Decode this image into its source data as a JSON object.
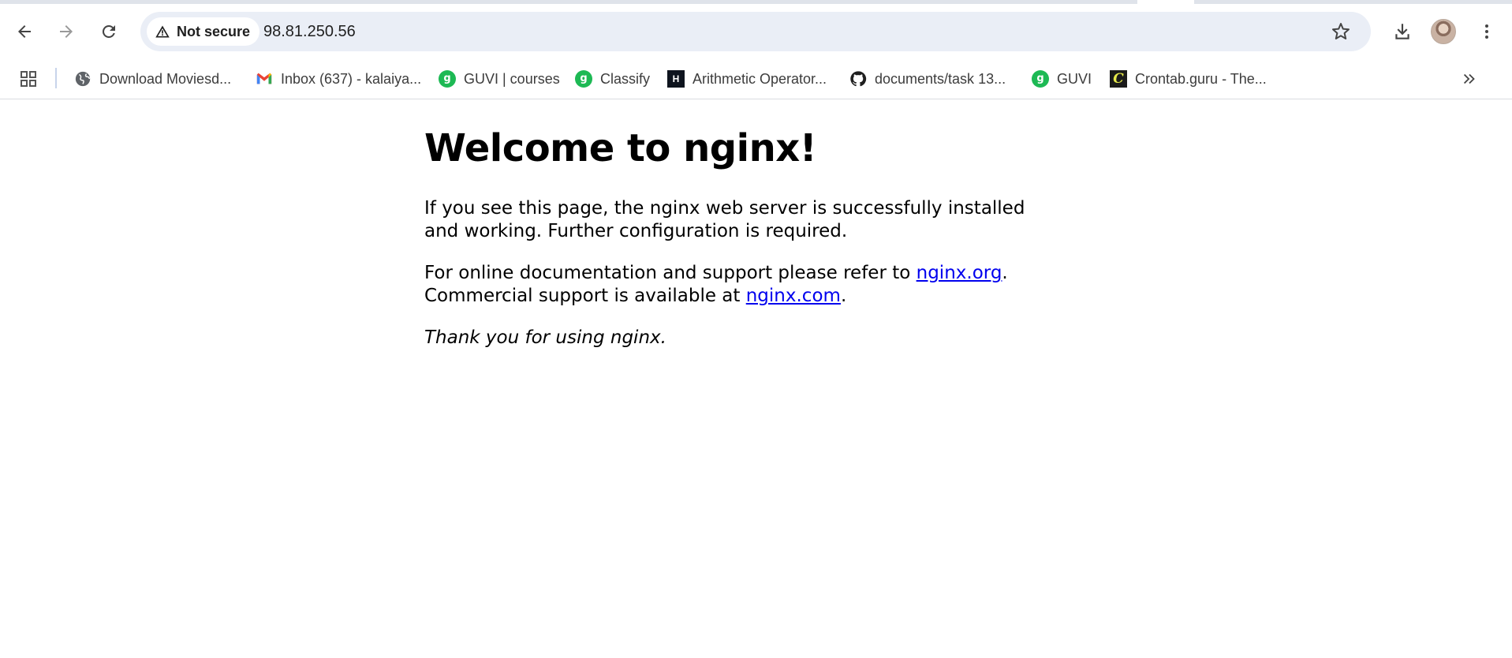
{
  "browser": {
    "security_chip": "Not secure",
    "url": "98.81.250.56",
    "back_label": "Back",
    "forward_label": "Forward",
    "reload_label": "Reload"
  },
  "bookmarks": [
    {
      "label": "Download Moviesd...",
      "icon": "globe-icon"
    },
    {
      "label": "Inbox (637) - kalaiya...",
      "icon": "gmail-icon"
    },
    {
      "label": "GUVI | courses",
      "icon": "guvi-icon"
    },
    {
      "label": "Classify",
      "icon": "guvi-icon"
    },
    {
      "label": "Arithmetic Operator...",
      "icon": "hackerrank-icon"
    },
    {
      "label": "documents/task 13...",
      "icon": "github-icon"
    },
    {
      "label": "GUVI",
      "icon": "guvi-icon"
    },
    {
      "label": "Crontab.guru - The...",
      "icon": "crontab-icon"
    }
  ],
  "page": {
    "heading": "Welcome to nginx!",
    "p1": "If you see this page, the nginx web server is successfully installed and working. Further configuration is required.",
    "p2_text1": "For online documentation and support please refer to ",
    "p2_link1": "nginx.org",
    "p2_text2": ".",
    "p2_text3": "Commercial support is available at ",
    "p2_link2": "nginx.com",
    "p2_text4": ".",
    "p3": "Thank you for using nginx."
  },
  "colors": {
    "link": "#0000ee",
    "omnibox_bg": "#eaeef6",
    "guvi_green": "#1db954"
  }
}
